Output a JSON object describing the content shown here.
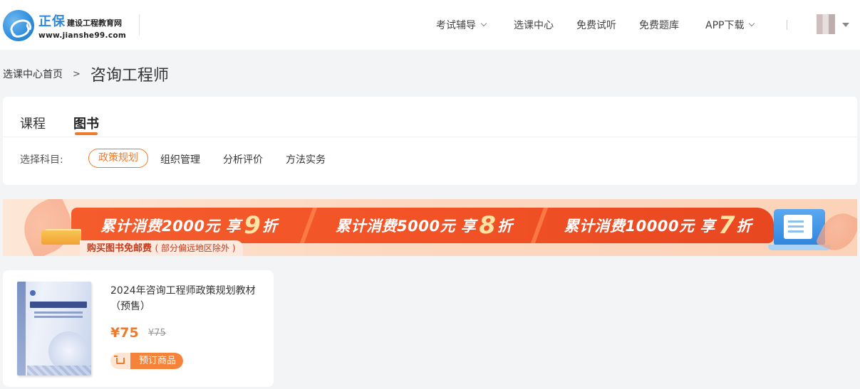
{
  "header": {
    "logo_name": "正保",
    "logo_subtitle": "建设工程教育网",
    "logo_url": "www.jianshe99.com",
    "nav": [
      {
        "label": "考试辅导",
        "has_dropdown": true
      },
      {
        "label": "选课中心",
        "has_dropdown": false
      },
      {
        "label": "免费试听",
        "has_dropdown": false
      },
      {
        "label": "免费题库",
        "has_dropdown": false
      },
      {
        "label": "APP下载",
        "has_dropdown": true
      }
    ],
    "avatar_icon": "user-avatar"
  },
  "breadcrumb": {
    "home": "选课中心首页",
    "separator": ">",
    "current": "咨询工程师"
  },
  "tabs": [
    {
      "label": "课程",
      "active": false
    },
    {
      "label": "图书",
      "active": true
    }
  ],
  "filter": {
    "label": "选择科目:",
    "options": [
      {
        "label": "政策规划",
        "active": true
      },
      {
        "label": "组织管理",
        "active": false
      },
      {
        "label": "分析评价",
        "active": false
      },
      {
        "label": "方法实务",
        "active": false
      }
    ]
  },
  "banner": {
    "tiers": [
      {
        "text": "累计消费2000元 享",
        "discount": "9",
        "suffix": "折"
      },
      {
        "text": "累计消费5000元 享",
        "discount": "8",
        "suffix": "折"
      },
      {
        "text": "累计消费10000元 享",
        "discount": "7",
        "suffix": "折"
      }
    ],
    "shipping": "购买图书免邮费",
    "shipping_note": "( 部分偏远地区除外 )"
  },
  "products": [
    {
      "title": "2024年咨询工程师政策规划教材（预售）",
      "price": "¥75",
      "original_price": "¥75",
      "action": "预订商品"
    }
  ],
  "colors": {
    "accent": "#f07a2b",
    "banner_red": "#f25326",
    "brand_blue": "#2e86d8"
  }
}
